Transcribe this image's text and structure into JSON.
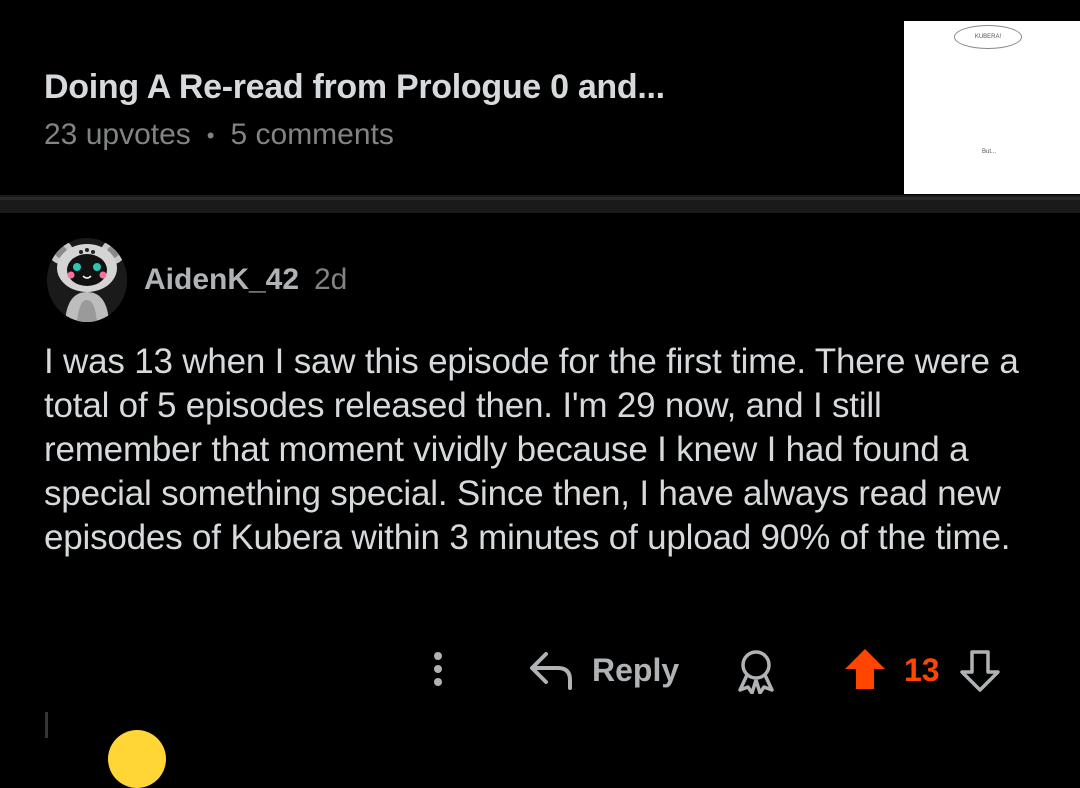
{
  "post": {
    "title": "Doing A Re-read from Prologue 0 and...",
    "upvotes": "23 upvotes",
    "separator": "•",
    "comments": "5 comments",
    "thumbnail": {
      "bubble_text": "KUBERA!",
      "caption_text": "But..."
    }
  },
  "comment": {
    "username": "AidenK_42",
    "age": "2d",
    "body": "I was 13 when I saw this episode for the first time. There were a total of 5 episodes released then. I'm 29 now, and I still remember that moment vividly because I knew I had found a special something special. Since then, I have always read new episodes of Kubera within 3 minutes of upload 90% of the time.",
    "actions": {
      "reply_label": "Reply",
      "vote_count": "13"
    }
  },
  "colors": {
    "background": "#000000",
    "text": "#d7dadc",
    "muted": "#818384",
    "upvote_active": "#ff4500"
  },
  "icons": [
    "more-vertical-icon",
    "reply-arrow-icon",
    "award-icon",
    "upvote-arrow-icon",
    "downvote-arrow-icon"
  ]
}
